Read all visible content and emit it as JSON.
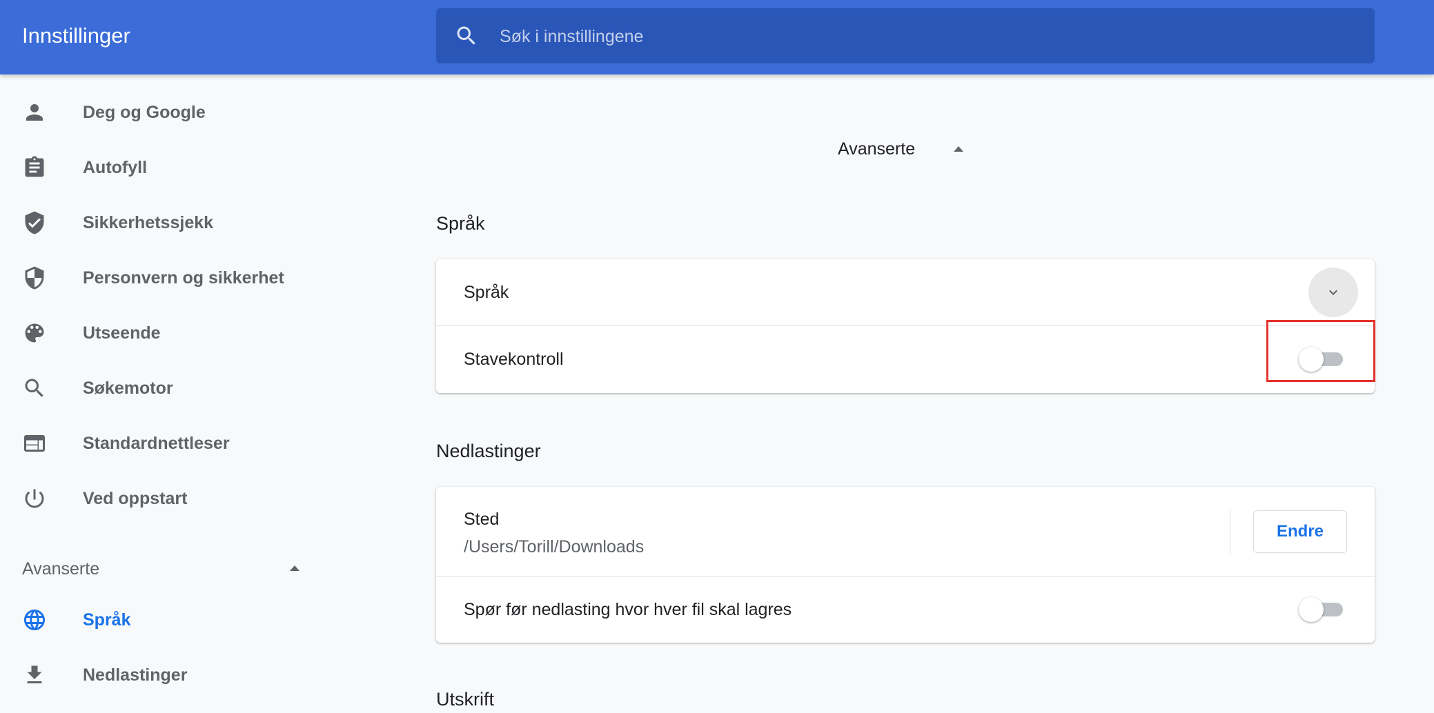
{
  "header": {
    "title": "Innstillinger",
    "search_placeholder": "Søk i innstillingene"
  },
  "sidebar": {
    "items": [
      {
        "label": "Deg og Google",
        "icon": "person-icon"
      },
      {
        "label": "Autofyll",
        "icon": "clipboard-icon"
      },
      {
        "label": "Sikkerhetssjekk",
        "icon": "shield-check-icon"
      },
      {
        "label": "Personvern og sikkerhet",
        "icon": "shield-half-icon"
      },
      {
        "label": "Utseende",
        "icon": "palette-icon"
      },
      {
        "label": "Søkemotor",
        "icon": "search-icon"
      },
      {
        "label": "Standardnettleser",
        "icon": "browser-window-icon"
      },
      {
        "label": "Ved oppstart",
        "icon": "power-icon"
      }
    ],
    "advanced": {
      "label": "Avanserte",
      "items": [
        {
          "label": "Språk",
          "icon": "globe-icon",
          "active": true
        },
        {
          "label": "Nedlastinger",
          "icon": "download-icon",
          "active": false
        }
      ]
    }
  },
  "main": {
    "advanced_label": "Avanserte",
    "sections": {
      "language": {
        "title": "Språk",
        "rows": {
          "language_label": "Språk",
          "spellcheck_label": "Stavekontroll",
          "spellcheck_enabled": false
        }
      },
      "downloads": {
        "title": "Nedlastinger",
        "location_label": "Sted",
        "location_path": "/Users/Torill/Downloads",
        "change_button": "Endre",
        "ask_label": "Spør før nedlasting hvor hver fil skal lagres",
        "ask_enabled": false
      },
      "print": {
        "title": "Utskrift"
      }
    }
  },
  "colors": {
    "header_bg": "#3b6cd8",
    "search_bg": "#2a56b8",
    "accent": "#1a73e8",
    "highlight": "#e5322d"
  }
}
